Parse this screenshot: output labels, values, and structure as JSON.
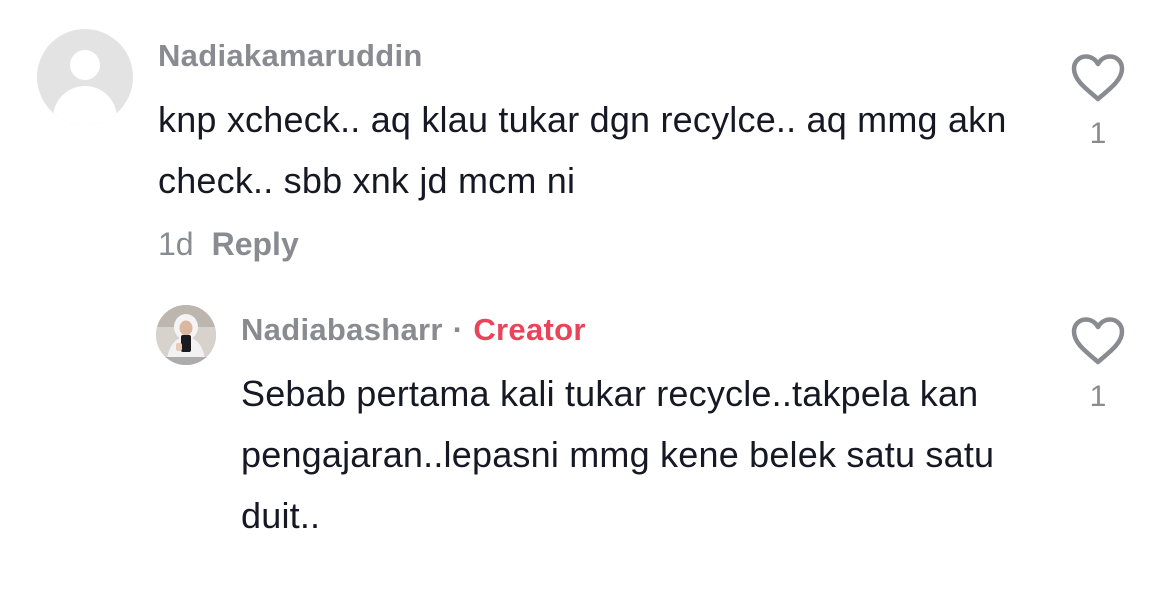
{
  "comment": {
    "username": "Nadiakamaruddin",
    "text": "knp xcheck.. aq klau tukar dgn recylce.. aq mmg akn check.. sbb xnk jd mcm ni",
    "time": "1d",
    "reply_label": "Reply",
    "like_count": "1",
    "avatar_icon": "default-avatar-icon",
    "like_icon": "heart-outline-icon"
  },
  "reply": {
    "username": "Nadiabasharr",
    "separator": "·",
    "badge": "Creator",
    "text": "Sebab pertama kali tukar recycle..takpela kan pengajaran..lepasni mmg kene belek satu satu duit..",
    "like_count": "1",
    "avatar_icon": "user-photo-avatar",
    "like_icon": "heart-outline-icon"
  },
  "colors": {
    "text_primary": "#161823",
    "text_secondary": "#8a8b91",
    "creator_accent": "#e8445a",
    "background": "#ffffff"
  }
}
